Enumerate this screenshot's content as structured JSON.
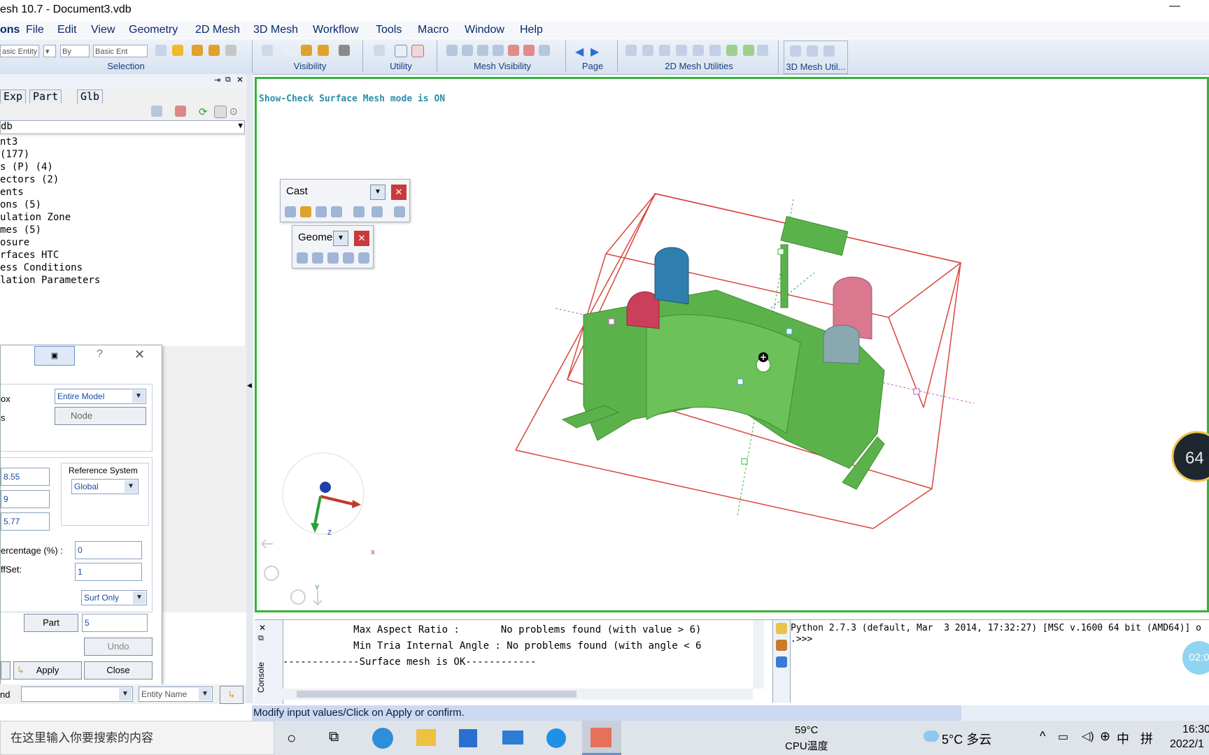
{
  "window": {
    "title": "esh 10.7 - Document3.vdb",
    "minimize_glyph": "—"
  },
  "menu": [
    "ons",
    "File",
    "Edit",
    "View",
    "Geometry",
    "2D Mesh",
    "3D Mesh",
    "Workflow",
    "Tools",
    "Macro",
    "Window",
    "Help"
  ],
  "toolbar": {
    "groups": [
      "Selection",
      "Visibility",
      "Utility",
      "Mesh Visibility",
      "Page",
      "2D Mesh Utilities",
      "3D Mesh Util..."
    ],
    "selection_combos": [
      "asic Entity",
      "By",
      "Basic Ent"
    ]
  },
  "leftpanel": {
    "tabs": [
      "Exp",
      "Part",
      "Glb"
    ],
    "combo": "db",
    "tree": [
      "nt3",
      "(177)",
      "s (P) (4)",
      "ectors (2)",
      "ents",
      "ons (5)",
      "ulation Zone",
      "mes (5)",
      "osure",
      "rfaces HTC",
      "ess Conditions",
      "lation Parameters"
    ]
  },
  "dialog": {
    "help": "?",
    "close": "✕",
    "row1_label": "ox",
    "row1_value": "Entire Model",
    "row2_label": "s",
    "row2_value": "Node",
    "values": [
      "8.55",
      "9",
      "5.77"
    ],
    "ref_title": "Reference System",
    "ref_value": "Global",
    "pct_label": "ercentage (%) :",
    "pct_value": "0",
    "offset_label": "ffSet:",
    "offset_value": "1",
    "surf_value": "Surf Only",
    "part_btn": "Part",
    "part_value": "5",
    "undo": "Undo",
    "apply": "Apply",
    "close_btn": "Close"
  },
  "bottomleft": {
    "label": "nd",
    "entity_name": "Entity Name"
  },
  "viewport": {
    "mode_text": "Show-Check Surface Mesh mode is ON",
    "cast_palette": "Cast",
    "geom_palette": "Geome",
    "axis_x": "x",
    "axis_y": "Y",
    "axis_z": "Z",
    "badge": "64"
  },
  "console": {
    "tab_console": "Console",
    "lines": [
      "            Max Aspect Ratio :       No problems found (with value > 6)",
      "            Min Tria Internal Angle : No problems found (with angle < 6 ",
      "-------------Surface mesh is OK------------"
    ],
    "python": [
      "Python 2.7.3 (default, Mar  3 2014, 17:32:27) [MSC v.1600 64 bit (AMD64)] o",
      ".>>>"
    ],
    "timer": "02:0"
  },
  "status": "Modify input values/Click on Apply or confirm.",
  "taskbar": {
    "search_placeholder": "在这里输入你要搜索的内容",
    "cpu_temp": "59°C",
    "cpu_label": "CPU温度",
    "weather": "5°C 多云",
    "ime": "中",
    "ime2": "拼",
    "time": "16:30",
    "date": "2022/1"
  },
  "colors": {
    "viewport_border": "#36b336",
    "part_green": "#5cb24a",
    "bbox_red": "#d9463c",
    "accent_blue": "#1b3d7a"
  }
}
